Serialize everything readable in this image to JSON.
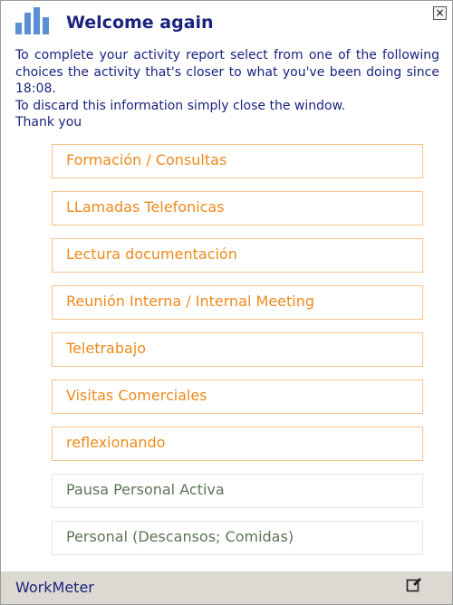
{
  "window": {
    "title": "Welcome again",
    "close_label": "×"
  },
  "intro": {
    "line1": "To complete your activity report select from one of the following choices the activity that's closer to what you've been doing since 18:08.",
    "line2": "To discard this information simply close the window.",
    "line3": "Thank you"
  },
  "options": [
    {
      "label": "Formación / Consultas"
    },
    {
      "label": "LLamadas Telefonicas"
    },
    {
      "label": "Lectura documentación"
    },
    {
      "label": "Reunión Interna / Internal Meeting"
    },
    {
      "label": "Teletrabajo"
    },
    {
      "label": "Visitas Comerciales"
    },
    {
      "label": "reflexionando"
    },
    {
      "label": "Pausa Personal Activa"
    },
    {
      "label": "Personal (Descansos; Comidas)"
    }
  ],
  "footer": {
    "brand": "WorkMeter",
    "edit_icon": "edit-icon"
  },
  "colors": {
    "title": "#1a237e",
    "work_option_text": "#ee8a1c",
    "work_option_border": "#f5c38b",
    "personal_option_text": "#5d7556",
    "personal_option_border": "#e3e6e9",
    "footer_bg": "#dcd8d2",
    "logo": "#5b8fd3"
  }
}
